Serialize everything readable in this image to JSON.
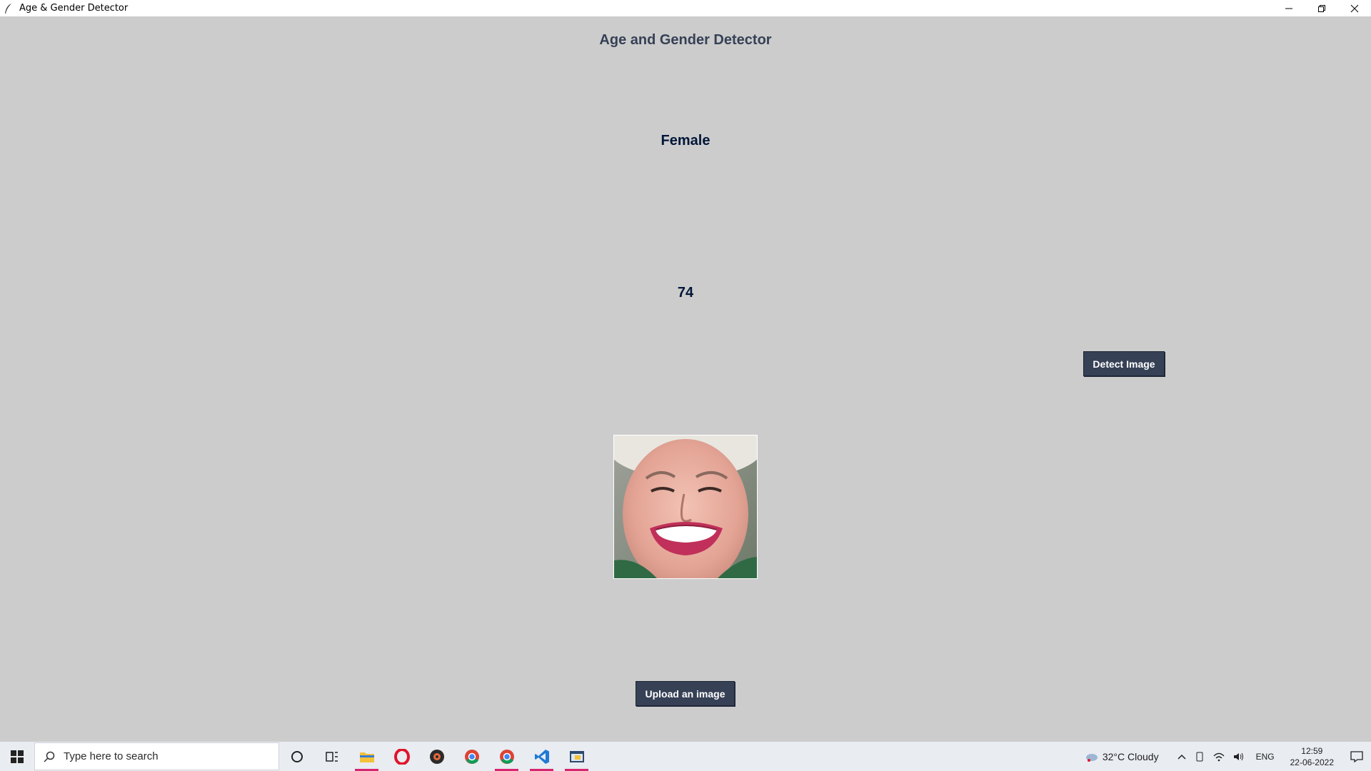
{
  "window": {
    "title": "Age & Gender Detector"
  },
  "app": {
    "heading": "Age and Gender Detector",
    "gender_result": "Female",
    "age_result": "74",
    "detect_button": "Detect Image",
    "upload_button": "Upload an image",
    "colors": {
      "background": "#cccccc",
      "heading": "#364156",
      "result_text": "#011638",
      "button_bg": "#364156",
      "button_text": "#ffffff"
    }
  },
  "taskbar": {
    "search_placeholder": "Type here to search",
    "pinned_icons": [
      "task-view-circle-icon",
      "widgets-icon",
      "file-explorer-icon",
      "opera-icon",
      "media-player-icon",
      "chrome-icon",
      "chrome-profile-icon",
      "vscode-icon",
      "python-app-icon"
    ],
    "weather": "32°C  Cloudy",
    "language": "ENG",
    "time": "12:59",
    "date": "22-06-2022"
  }
}
